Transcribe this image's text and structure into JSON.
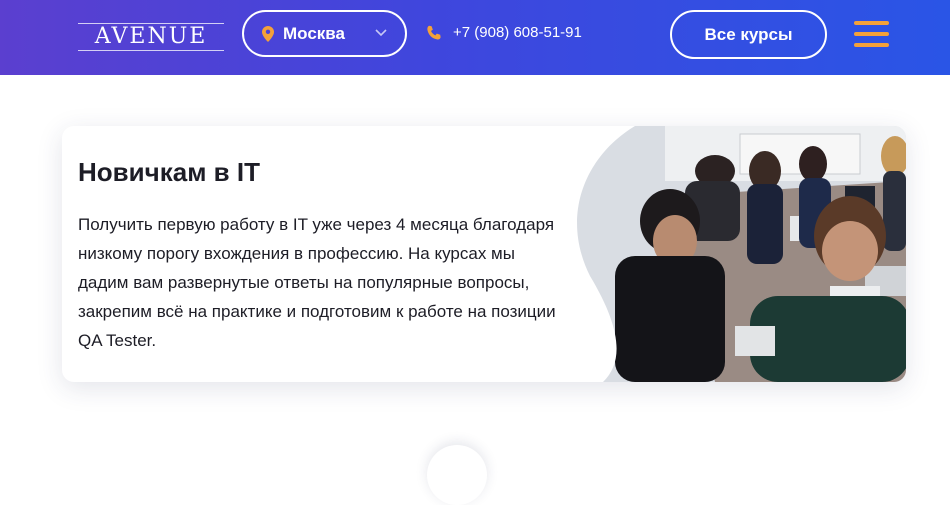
{
  "header": {
    "logo_text": "AVENUE",
    "city": "Москва",
    "phone": "+7 (908) 608-51-91",
    "courses_button": "Все курсы"
  },
  "card": {
    "title": "Новичкам в IT",
    "text": "Получить первую работу в IT уже через 4 месяца благодаря низкому порогу вхождения в профессию. На курсах мы дадим вам развернутые ответы на популярные вопросы, закрепим всё на практике и подготовим к работе на позиции QA Tester."
  },
  "icons": {
    "pin": "map-pin-icon",
    "chevron": "chevron-down-icon",
    "phone": "phone-icon",
    "menu": "hamburger-menu-icon"
  },
  "colors": {
    "header_gradient_start": "#5b3fcf",
    "header_gradient_end": "#2a55e6",
    "accent_orange": "#f4a13a",
    "text_dark": "#1d1d26"
  }
}
